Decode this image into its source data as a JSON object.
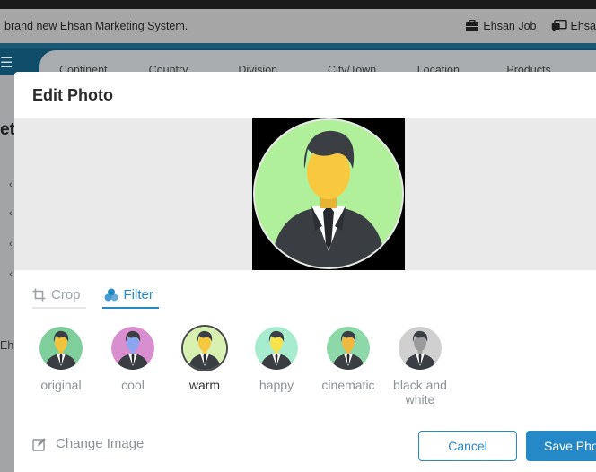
{
  "announcement": {
    "message": "brand new Ehsan Marketing System.",
    "links": [
      {
        "label": "Ehsan Job",
        "icon": "briefcase-icon"
      },
      {
        "label": "Ehsa",
        "icon": "chat-icon"
      }
    ]
  },
  "filter_bar": {
    "items": [
      "Continent",
      "Country",
      "Division",
      "City/Town",
      "Location",
      "Products"
    ]
  },
  "page": {
    "title_fragment": "ett",
    "side_fragment": "Ehs"
  },
  "modal": {
    "title": "Edit Photo",
    "tabs": [
      {
        "label": "Crop",
        "icon": "crop-icon"
      },
      {
        "label": "Filter",
        "icon": "color-filter-icon"
      }
    ],
    "active_tab": "Filter",
    "filters": [
      {
        "label": "original",
        "bg": "#7fcf9c",
        "face": "#f2c23c"
      },
      {
        "label": "cool",
        "bg": "#d98fcf",
        "face": "#8aa6f0"
      },
      {
        "label": "warm",
        "bg": "#d8f0b0",
        "face": "#f5c840"
      },
      {
        "label": "happy",
        "bg": "#a8ecd0",
        "face": "#f6e24a"
      },
      {
        "label": "cinematic",
        "bg": "#8dd8a8",
        "face": "#f0b840"
      },
      {
        "label": "black and white",
        "bg": "#d0d0d0",
        "face": "#9a9a9a"
      }
    ],
    "active_filter": "warm",
    "change_image_label": "Change Image",
    "cancel_label": "Cancel",
    "save_label": "Save Photo"
  },
  "colors": {
    "accent": "#2589c8",
    "avatar_bg": "#b0f09a",
    "face": "#f8c93e",
    "suit": "#3a3d42",
    "hair": "#3b3f44"
  }
}
